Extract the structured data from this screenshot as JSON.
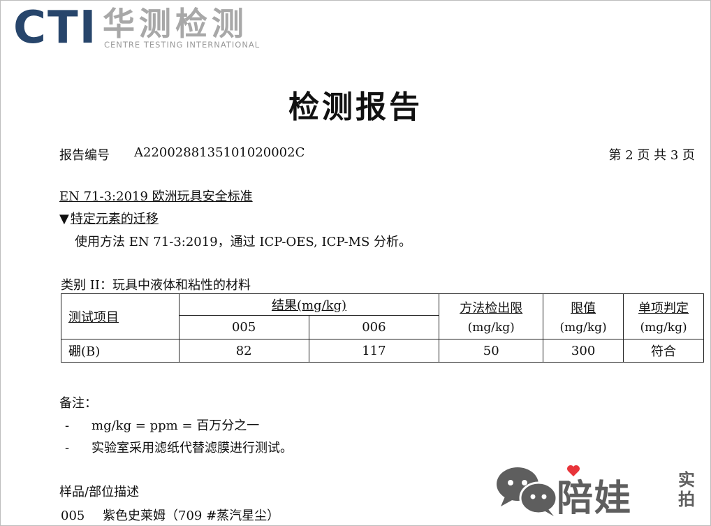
{
  "logo": {
    "brand": "CTI",
    "cn_name": "华测检测",
    "en_name": "CENTRE TESTING INTERNATIONAL"
  },
  "doc_title": "检测报告",
  "meta": {
    "report_no_label": "报告编号",
    "report_no": "A2200288135101020002C",
    "page": "第 2 页 共 3 页"
  },
  "section": {
    "standard": "EN 71-3:2019  欧洲玩具安全标准",
    "marker": "▼",
    "subtitle": "特定元素的迁移",
    "method": "使用方法 EN 71-3:2019，通过 ICP-OES, ICP-MS 分析。",
    "category": "类别 II：玩具中液体和粘性的材料"
  },
  "table": {
    "col_item": "测试项目",
    "col_result": "结果(mg/kg)",
    "col_result_a": "005",
    "col_result_b": "006",
    "col_mdl": "方法检出限",
    "col_mdl_unit": "(mg/kg)",
    "col_limit": "限值",
    "col_limit_unit": "(mg/kg)",
    "col_judge": "单项判定",
    "col_judge_unit": "(mg/kg)",
    "rows": [
      {
        "item": "硼(B)",
        "r005": "82",
        "r006": "117",
        "mdl": "50",
        "limit": "300",
        "judge": "符合"
      }
    ]
  },
  "notes": {
    "title": "备注：",
    "dash": "-",
    "items": [
      "mg/kg = ppm =  百万分之一",
      "实验室采用滤纸代替滤膜进行测试。"
    ]
  },
  "sample": {
    "title": "样品/部位描述",
    "code": "005",
    "description": "紫色史莱姆（709 #蒸汽星尘）"
  },
  "watermark": {
    "text": "陪娃",
    "side": "实拍",
    "accent": "#e8343a"
  }
}
